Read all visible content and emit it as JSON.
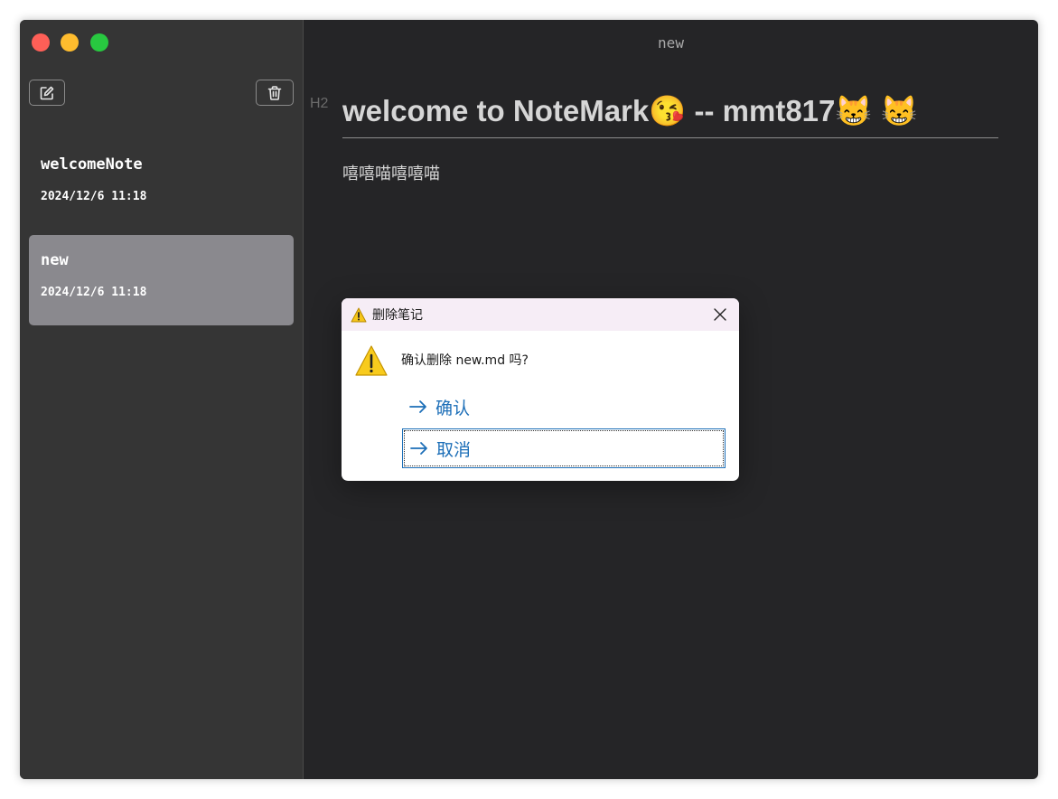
{
  "window": {
    "title": "new"
  },
  "sidebar": {
    "notes": [
      {
        "title": "welcomeNote",
        "date": "2024/12/6 11:18",
        "selected": false
      },
      {
        "title": "new",
        "date": "2024/12/6 11:18",
        "selected": true
      }
    ]
  },
  "editor": {
    "heading_marker": "H2",
    "heading": "welcome to NoteMark😘 -- mmt817😸 😸",
    "body": "嘻嘻喵嘻嘻喵"
  },
  "dialog": {
    "title": "删除笔记",
    "message": "确认删除 new.md 吗?",
    "confirm_label": "确认",
    "cancel_label": "取消"
  },
  "colors": {
    "sidebar_bg": "#353535",
    "editor_bg": "#252527",
    "selected_note_bg": "#8a898e",
    "link_blue": "#1d6fb8"
  },
  "icons": [
    "new-note-icon",
    "trash-icon",
    "warning-icon",
    "close-icon",
    "arrow-right-icon"
  ]
}
